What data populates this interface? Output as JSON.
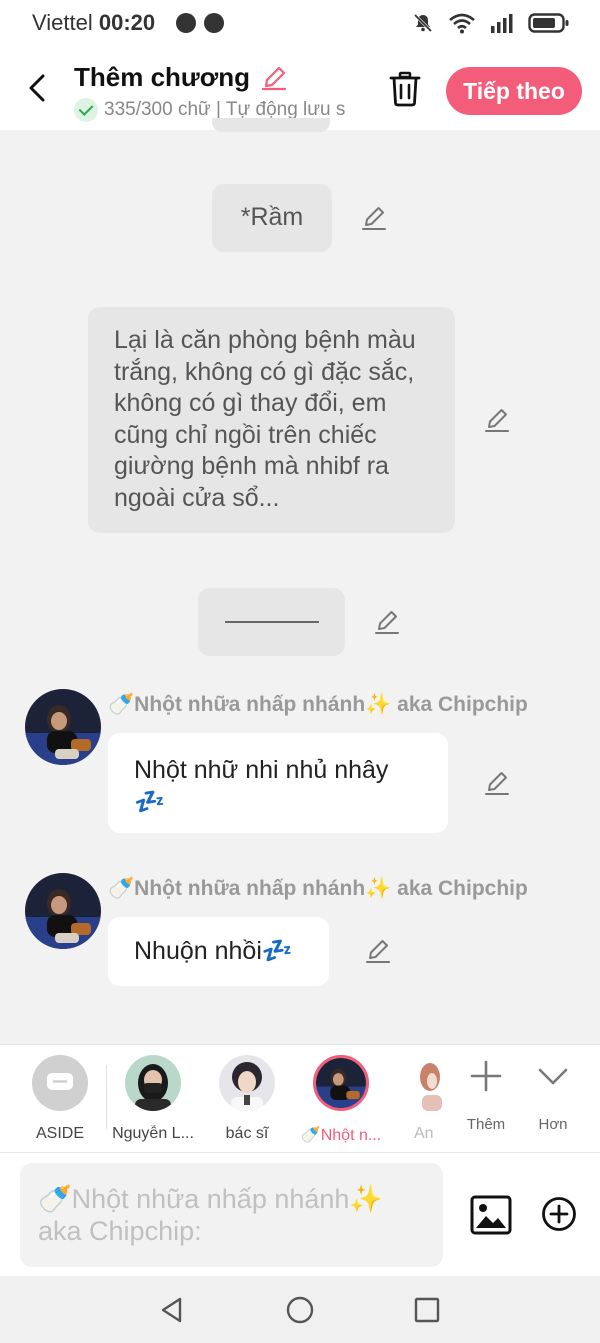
{
  "status": {
    "carrier": "Viettel",
    "time": "00:20"
  },
  "header": {
    "title": "Thêm chương",
    "subtitle": "335/300 chữ | Tự động lưu s",
    "next_label": "Tiếp theo"
  },
  "messages": {
    "m1": "*Rầm",
    "m2": "Lại là căn phòng bệnh màu trắng, không có gì đặc sắc, không có gì thay đổi, em cũng chỉ ngồi trên chiếc giường bệnh mà nhibf ra ngoài cửa sổ...",
    "m4_speaker": "🍼Nhột nhữa nhấp nhánh✨ aka Chipchip",
    "m4_text": "Nhột nhữ nhi nhủ nhây 💤",
    "m5_speaker": "🍼Nhột nhữa nhấp nhánh✨ aka Chipchip",
    "m5_text": "Nhuộn nhồi💤"
  },
  "characters": [
    {
      "name": "ASIDE"
    },
    {
      "name": "Nguyễn L..."
    },
    {
      "name": "bác sĩ"
    },
    {
      "name": "🍼Nhột n..."
    },
    {
      "name": "An"
    }
  ],
  "tools": {
    "add_label": "Thêm",
    "more_label": "Hơn"
  },
  "input": {
    "placeholder": "🍼Nhột nhữa nhấp nhánh✨ aka Chipchip:"
  },
  "colors": {
    "accent": "#f45d7a",
    "bubble_gray": "#e6e6e6",
    "background": "#f2f2f2",
    "check_green": "#2aa84a"
  }
}
